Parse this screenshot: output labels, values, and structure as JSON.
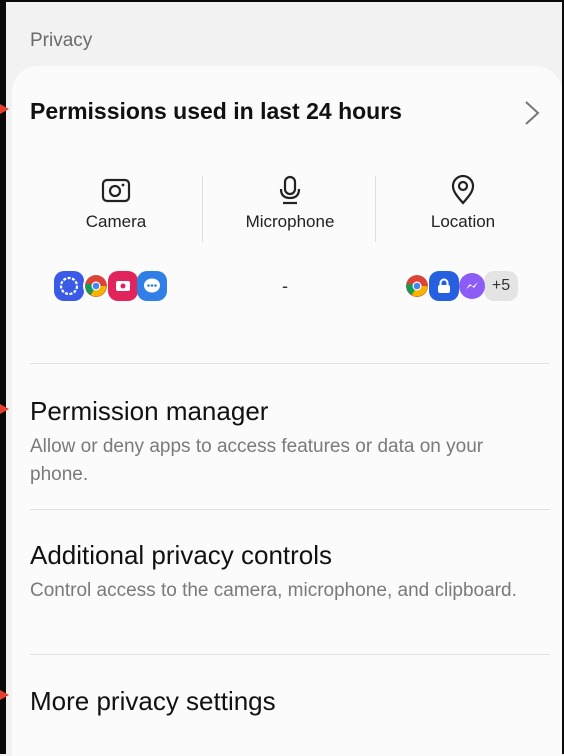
{
  "section": {
    "title": "Privacy"
  },
  "permissions_card": {
    "title": "Permissions used in last 24 hours",
    "columns": [
      {
        "label": "Camera",
        "icon": "camera-icon"
      },
      {
        "label": "Microphone",
        "icon": "microphone-icon"
      },
      {
        "label": "Location",
        "icon": "location-pin-icon"
      }
    ],
    "camera_apps": [
      "signal-app-icon",
      "chrome-app-icon",
      "screen-recorder-app-icon",
      "messages-app-icon"
    ],
    "microphone_apps_placeholder": "-",
    "location_apps": [
      "chrome-app-icon",
      "samsung-app-icon",
      "messenger-app-icon"
    ],
    "location_more": "+5"
  },
  "items": [
    {
      "title": "Permission manager",
      "subtitle": "Allow or deny apps to access features or data on your phone."
    },
    {
      "title": "Additional privacy controls",
      "subtitle": "Control access to the camera, microphone, and clipboard."
    },
    {
      "title": "More privacy settings"
    }
  ],
  "colors": {
    "background": "#f2f2f2",
    "card": "#fbfbfb",
    "annotation_arrow": "#e2402b"
  }
}
